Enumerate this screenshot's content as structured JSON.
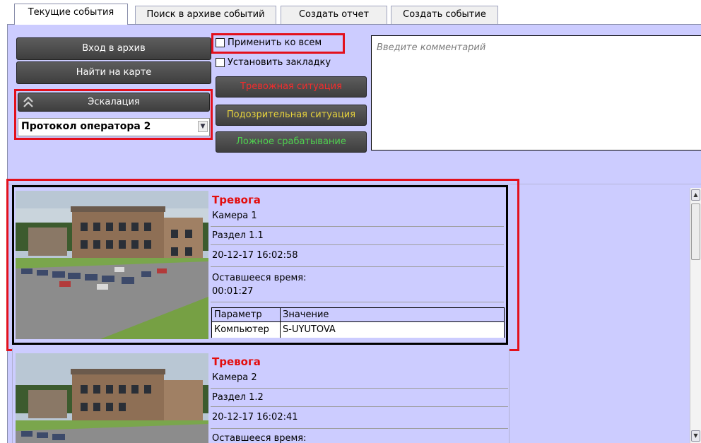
{
  "tabs": [
    {
      "label": "Текущие события",
      "active": true
    },
    {
      "label": "Поиск в архиве событий",
      "active": false
    },
    {
      "label": "Создать отчет",
      "active": false
    },
    {
      "label": "Создать событие",
      "active": false
    }
  ],
  "controls": {
    "archive_button": "Вход в архив",
    "map_button": "Найти на карте",
    "escalation_button": "Эскалация",
    "protocol_select": "Протокол оператора 2",
    "apply_all_label": "Применить ко всем",
    "bookmark_label": "Установить закладку",
    "alarm_button": "Тревожная ситуация",
    "suspicious_button": "Подозрительная ситуация",
    "false_button": "Ложное срабатывание",
    "comment_placeholder": "Введите комментарий"
  },
  "colors": {
    "panel_bg": "#ccccff",
    "highlight": "#e3101c",
    "alarm_text": "#f32c2c",
    "suspicious_text": "#e6d23c",
    "false_text": "#4fd14f",
    "event_title": "#e30d0d"
  },
  "events": [
    {
      "title": "Тревога",
      "camera": "Камера 1",
      "section": "Раздел 1.1",
      "datetime": "20-12-17 16:02:58",
      "remaining_label": "Оставшееся время:",
      "remaining_value": "00:01:27",
      "table_headers": [
        "Параметр",
        "Значение"
      ],
      "table_rows": [
        [
          "Компьютер",
          "S-UYUTOVA"
        ]
      ]
    },
    {
      "title": "Тревога",
      "camera": "Камера 2",
      "section": "Раздел 1.2",
      "datetime": "20-12-17 16:02:41",
      "remaining_label": "Оставшееся время:"
    }
  ],
  "icons": {
    "escalation": "chevron-up-double-icon",
    "select_arrow": "chevron-down-icon",
    "scroll_up": "chevron-up-icon",
    "scroll_down": "chevron-down-icon"
  }
}
